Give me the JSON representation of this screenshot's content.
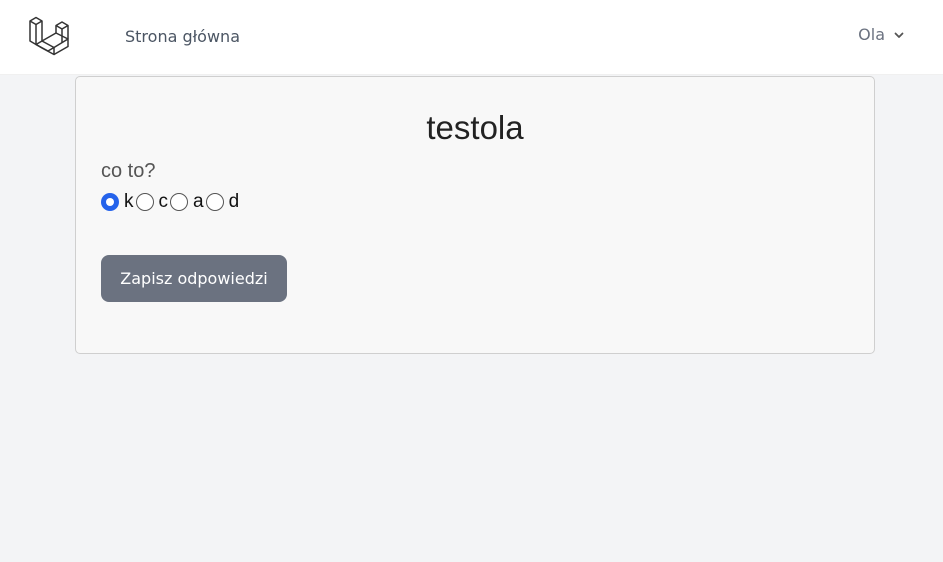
{
  "navbar": {
    "logo_icon": "laravel-logo-icon",
    "home_link": "Strona główna",
    "user_name": "Ola",
    "user_menu_icon": "chevron-down-icon"
  },
  "quiz": {
    "title": "testola",
    "question": "co to?",
    "answers": [
      {
        "label": "k",
        "checked": true
      },
      {
        "label": "c",
        "checked": false
      },
      {
        "label": "a",
        "checked": false
      },
      {
        "label": "d",
        "checked": false
      }
    ],
    "submit_label": "Zapisz odpowiedzi"
  },
  "colors": {
    "accent": "#2563eb",
    "button": "#6b7280",
    "background": "#f3f4f6"
  }
}
